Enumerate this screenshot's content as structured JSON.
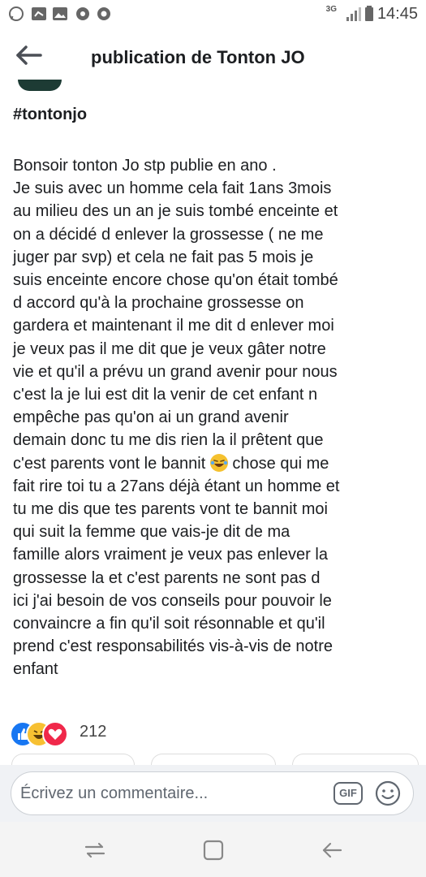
{
  "status_bar": {
    "network": "3G",
    "time": "14:45"
  },
  "header": {
    "title": "publication de Tonton JO"
  },
  "post": {
    "hashtag": "#tontonjo",
    "text_before_emoji": "Bonsoir tonton Jo stp publie en ano .\nJe suis avec un homme cela fait 1ans 3mois\nau milieu des un an je suis tombé enceinte et\non a décidé d enlever la grossesse ( ne me\njuger par svp) et cela ne fait pas 5 mois je\nsuis enceinte encore chose qu'on était tombé\nd accord qu'à la prochaine grossesse on\ngardera et maintenant il me dit d enlever moi\nje veux pas il me dit que je veux gâter notre\nvie et qu'il a prévu un grand avenir pour nous\nc'est la je lui est dit la venir de cet enfant n\nempêche pas qu'on ai un grand avenir\ndemain donc tu me dis rien la il prêtent que\nc'est parents vont le bannit ",
    "emoji": "laughing-tears-emoji",
    "text_after_emoji": " chose qui me\nfait rire toi tu a 27ans déjà étant un homme et\ntu me dis que tes parents vont te bannit moi\nqui suit la femme que vais-je dit de ma\nfamille alors vraiment je veux pas enlever la\ngrossesse la et c'est parents ne sont pas d\nici j'ai besoin de vos conseils pour pouvoir le\nconvaincre a fin qu'il soit résonnable et qu'il\nprend c'est responsabilités vis-à-vis de notre\nenfant"
  },
  "reactions": {
    "icons": [
      "like-icon",
      "haha-icon",
      "love-icon"
    ],
    "count": "212"
  },
  "comment_bar": {
    "placeholder": "Écrivez un commentaire...",
    "gif_label": "GIF"
  },
  "colors": {
    "like": "#1877f2",
    "haha": "#f7c032",
    "love": "#f0284a",
    "comment_bg": "#f0f2f5"
  }
}
